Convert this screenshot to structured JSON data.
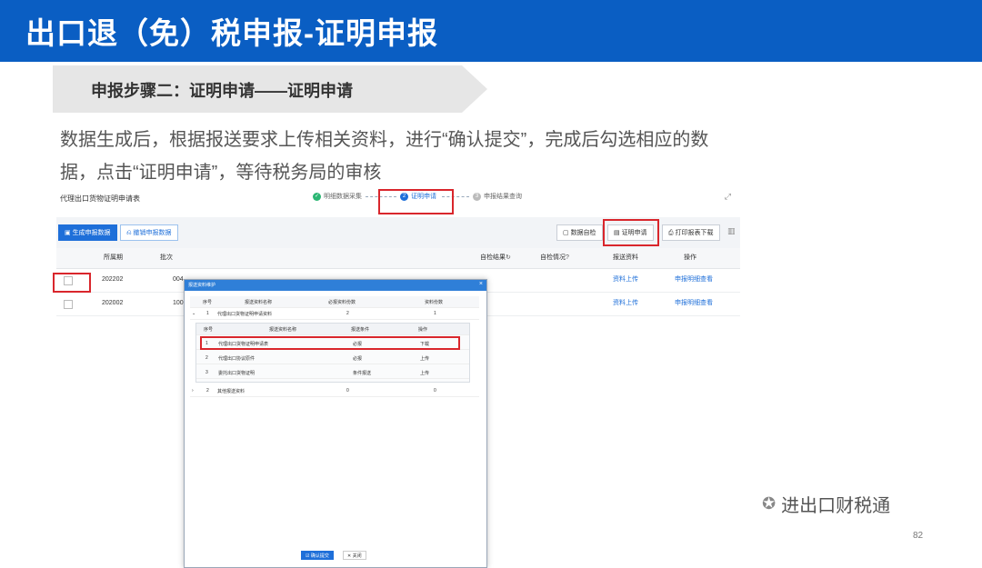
{
  "slide": {
    "title": "出口退（免）税申报-证明申报",
    "step_banner": "申报步骤二：证明申请——证明申请",
    "description": "数据生成后，根据报送要求上传相关资料，进行“确认提交”，完成后勾选相应的数据，点击“证明申请”，等待税务局的审核",
    "page_number": "82",
    "watermark": "进出口财税通"
  },
  "app": {
    "window_title": "代理出口货物证明申请表",
    "steps": [
      {
        "num": "✓",
        "label": "明细数据采集"
      },
      {
        "num": "2",
        "label": "证明申请"
      },
      {
        "num": "3",
        "label": "申报结果查询"
      }
    ],
    "buttons": {
      "generate": "生成申报数据",
      "revoke": "撤销申报数据",
      "self_check": "数据自检",
      "apply": "证明申请",
      "print": "打印报表下载"
    },
    "columns": {
      "period": "所属期",
      "batch": "批次",
      "result": "自检结果",
      "check_status": "自检情况",
      "materials": "报送资料",
      "actions": "操作"
    },
    "rows": [
      {
        "period": "202202",
        "batch": "004",
        "materials": "资料上传",
        "action": "申报明细查看"
      },
      {
        "period": "202002",
        "batch": "100",
        "materials": "资料上传",
        "action": "申报明细查看"
      }
    ]
  },
  "dialog": {
    "title": "报送资料维护",
    "close": "×",
    "headers": [
      "序号",
      "报送资料名称",
      "必报资料份数",
      "资料份数"
    ],
    "outer_rows": [
      {
        "no": "1",
        "name": "代理出口货物证明申请资料",
        "required": "2",
        "count": "1"
      },
      {
        "no": "2",
        "name": "其他报送资料",
        "required": "0",
        "count": "0"
      }
    ],
    "inner_headers": [
      "序号",
      "报送资料名称",
      "报送条件",
      "操作"
    ],
    "inner_rows": [
      {
        "no": "1",
        "name": "代理出口货物证明申请表",
        "cond": "必报",
        "op": "下载"
      },
      {
        "no": "2",
        "name": "代理出口协议原件",
        "cond": "必报",
        "op": "上传"
      },
      {
        "no": "3",
        "name": "委托出口货物证明",
        "cond": "条件报送",
        "op": "上传"
      }
    ],
    "confirm": "确认提交",
    "cancel": "关闭"
  }
}
